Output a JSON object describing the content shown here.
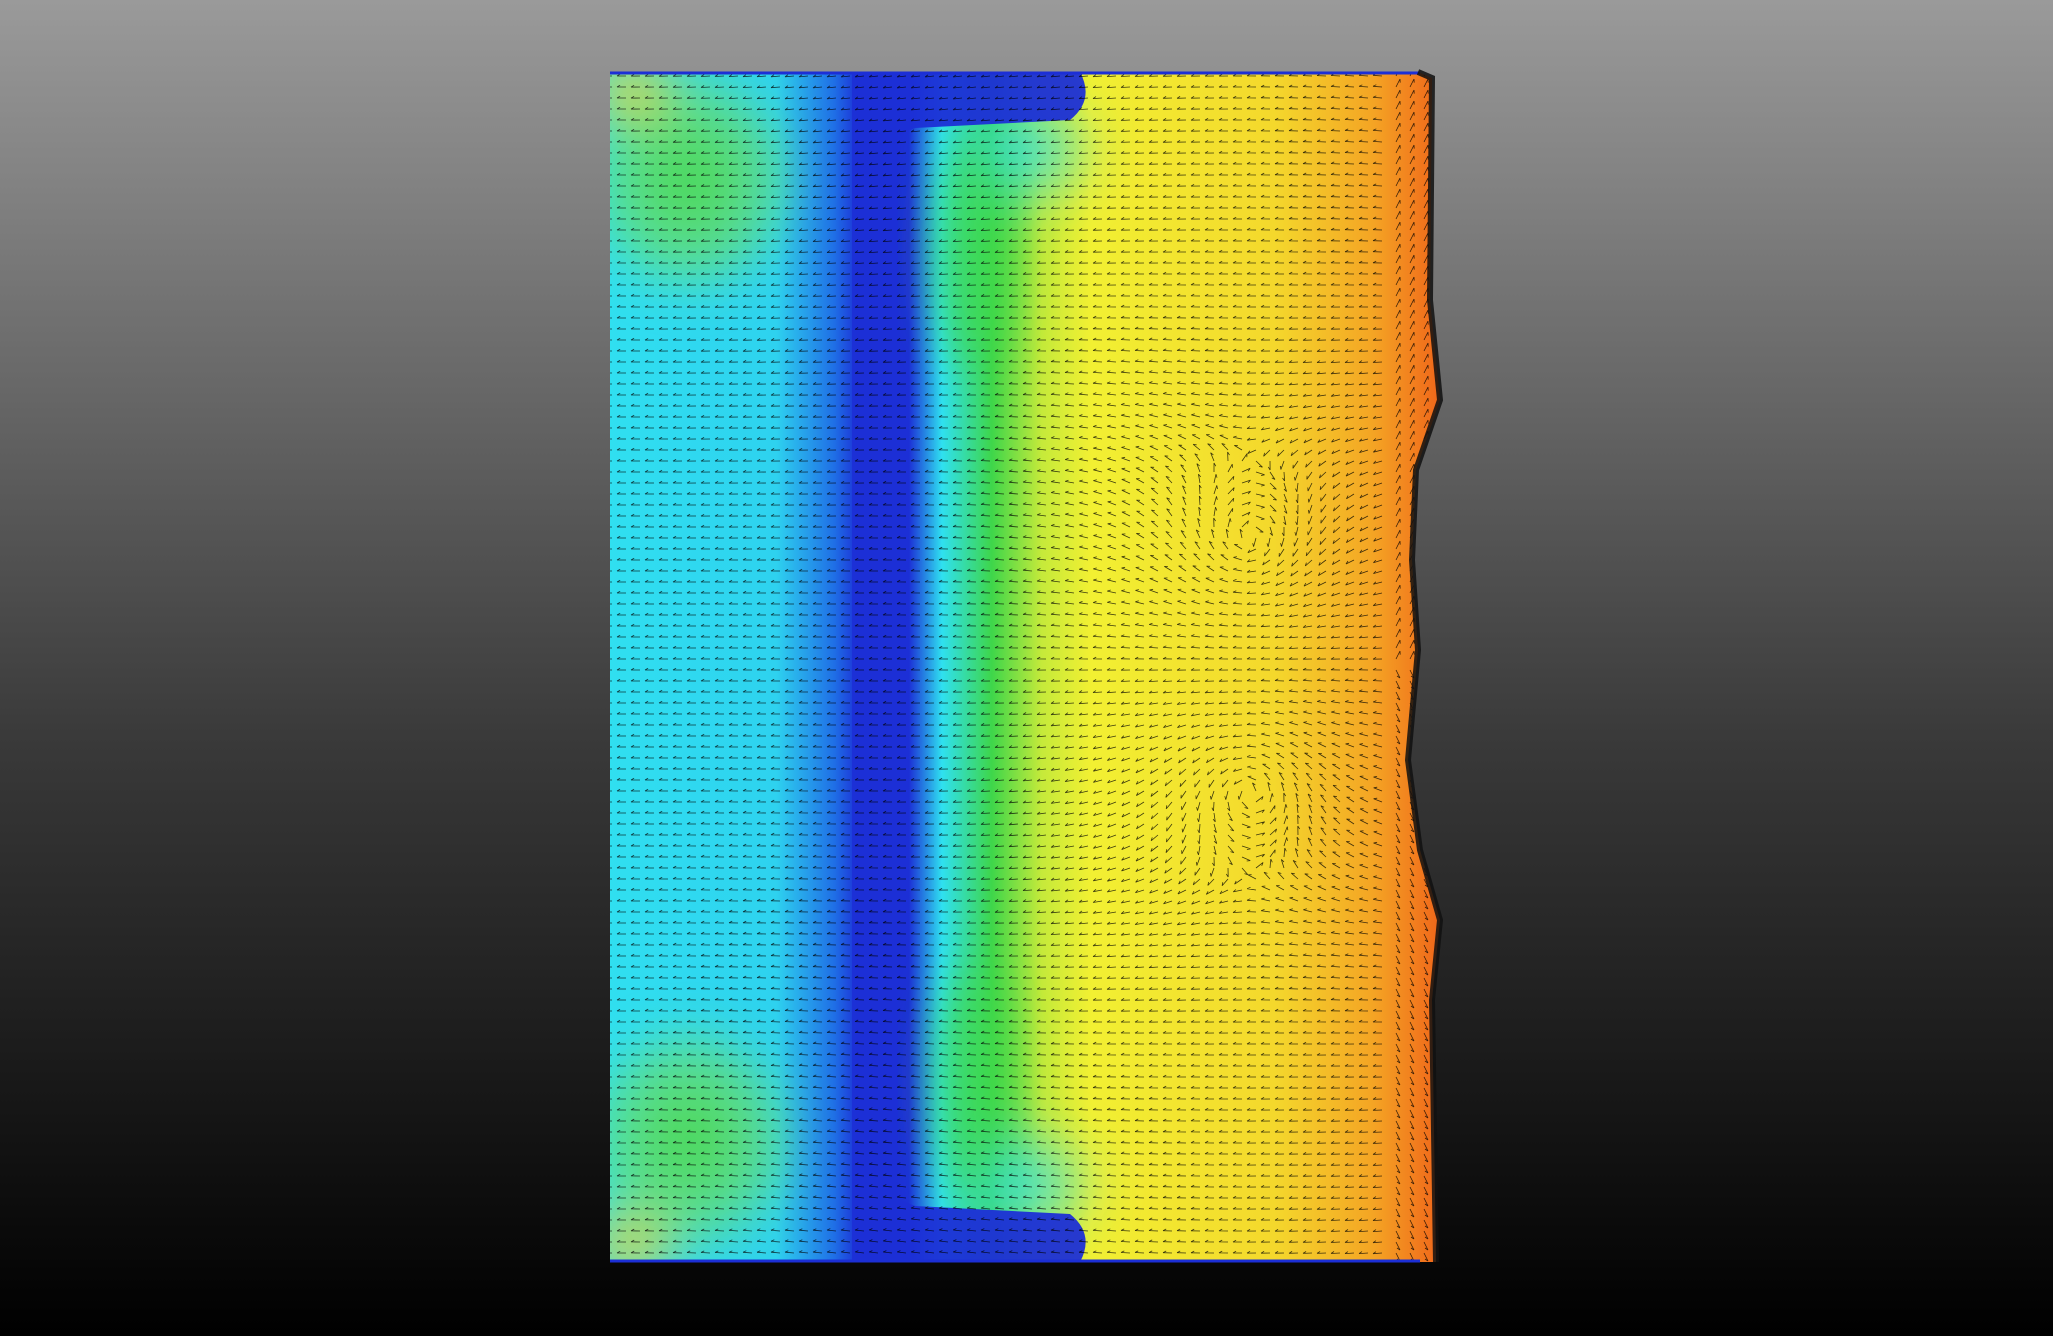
{
  "viewer": {
    "background_top": "#9a9a9a",
    "background_bottom": "#000000"
  },
  "field": {
    "colormap": [
      "#1c2fd6",
      "#2fe0f0",
      "#2fd64a",
      "#f2f032",
      "#f27a1c"
    ],
    "arrow_color": "#000000",
    "obstacle_color": "#1c2fd6"
  }
}
